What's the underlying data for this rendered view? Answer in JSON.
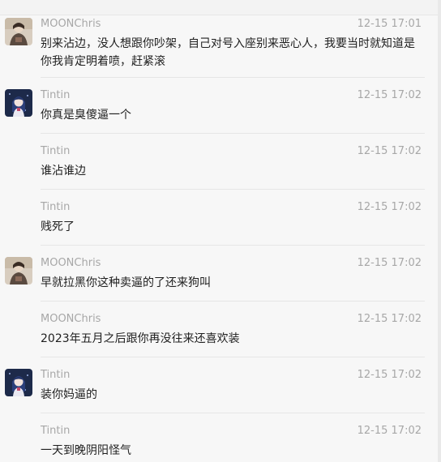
{
  "messages": [
    {
      "sender": "MOONChris",
      "time": "12-15 17:01",
      "text": "别来沾边，没人想跟你吵架，自己对号入座别来恶心人，我要当时就知道是你我肯定明着喷，赶紧滚",
      "avatar": "moonchris-avatar"
    },
    {
      "sender": "Tintin",
      "time": "12-15 17:02",
      "text": "你真是臭傻逼一个",
      "avatar": "tintin-avatar"
    },
    {
      "sender": "Tintin",
      "time": "12-15 17:02",
      "text": "谁沾谁边",
      "avatar": ""
    },
    {
      "sender": "Tintin",
      "time": "12-15 17:02",
      "text": "贱死了",
      "avatar": ""
    },
    {
      "sender": "MOONChris",
      "time": "12-15 17:02",
      "text": "早就拉黑你这种卖逼的了还来狗叫",
      "avatar": "moonchris-avatar"
    },
    {
      "sender": "MOONChris",
      "time": "12-15 17:02",
      "text": "2023年五月之后跟你再没往来还喜欢装",
      "avatar": ""
    },
    {
      "sender": "Tintin",
      "time": "12-15 17:02",
      "text": "装你妈逼的",
      "avatar": "tintin-avatar"
    },
    {
      "sender": "Tintin",
      "time": "12-15 17:02",
      "text": "一天到晚阴阳怪气",
      "avatar": ""
    }
  ]
}
